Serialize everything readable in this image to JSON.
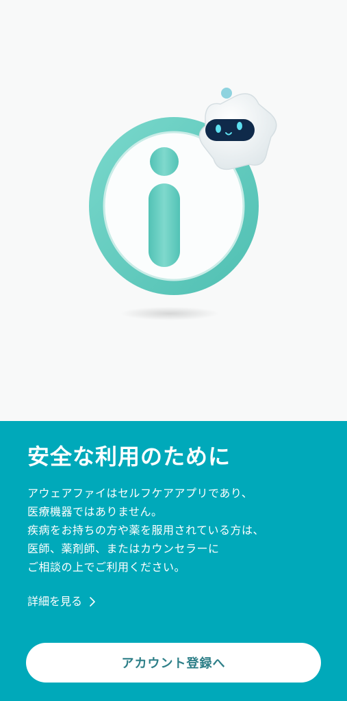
{
  "colors": {
    "accent": "#00a9ba",
    "illustration_bg": "#f8f9f9",
    "ring": "#5ecbbf",
    "button_text": "#2e7f88"
  },
  "illustration": {
    "main_icon": "info-icon",
    "mascot": "robot-star-mascot"
  },
  "info": {
    "title": "安全な利用のために",
    "body_lines": [
      "アウェアファイはセルフケアアプリであり、",
      "医療機器ではありません。",
      "疾病をお持ちの方や薬を服用されている方は、",
      "医師、薬剤師、またはカウンセラーに",
      "ご相談の上でご利用ください。"
    ],
    "details_link": "詳細を見る",
    "details_icon": "chevron-right-icon"
  },
  "actions": {
    "register_label": "アカウント登録へ"
  }
}
